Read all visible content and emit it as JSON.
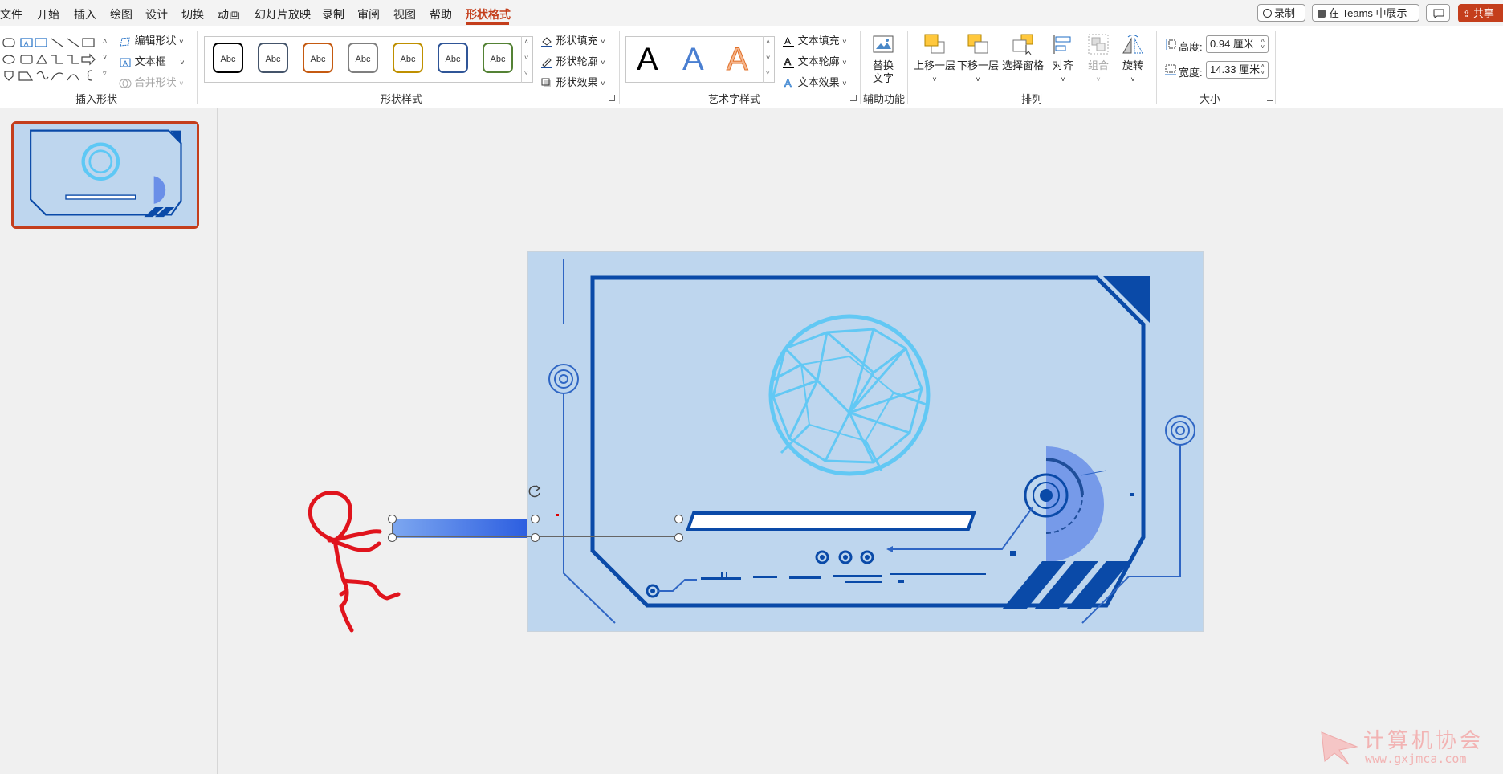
{
  "menu": {
    "items": [
      "文件",
      "开始",
      "插入",
      "绘图",
      "设计",
      "切换",
      "动画",
      "幻灯片放映",
      "录制",
      "审阅",
      "视图",
      "帮助",
      "形状格式"
    ],
    "active": "形状格式"
  },
  "top_buttons": {
    "record": "录制",
    "teams": "在 Teams 中展示",
    "share": "共享"
  },
  "ribbon": {
    "insert_shapes": {
      "edit_shape": "编辑形状",
      "text_box": "文本框",
      "merge_shapes": "合并形状",
      "label": "插入形状"
    },
    "shape_styles": {
      "sample": "Abc",
      "fill": "形状填充",
      "outline": "形状轮廓",
      "effects": "形状效果",
      "label": "形状样式",
      "style_colors": [
        "#000000",
        "#44546a",
        "#c55a11",
        "#7f7f7f",
        "#bf9000",
        "#2f5597",
        "#548235"
      ]
    },
    "wordart": {
      "sample": "A",
      "fill": "文本填充",
      "outline": "文本轮廓",
      "effects": "文本效果",
      "label": "艺术字样式"
    },
    "accessibility": {
      "alt_text_line1": "替换",
      "alt_text_line2": "文字",
      "label": "辅助功能"
    },
    "arrange": {
      "bring_forward": "上移一层",
      "send_backward": "下移一层",
      "selection_pane": "选择窗格",
      "align": "对齐",
      "group": "组合",
      "rotate": "旋转",
      "label": "排列"
    },
    "size": {
      "height_label": "高度:",
      "height_value": "0.94 厘米",
      "width_label": "宽度:",
      "width_value": "14.33 厘米",
      "label": "大小"
    }
  },
  "watermark": {
    "text": "计算机协会",
    "url": "www.gxjmca.com"
  },
  "colors": {
    "accent": "#c43e1c",
    "slide_bg": "#bed6ee",
    "frame_blue": "#0a4aa8",
    "globe": "#5ec8f5"
  }
}
